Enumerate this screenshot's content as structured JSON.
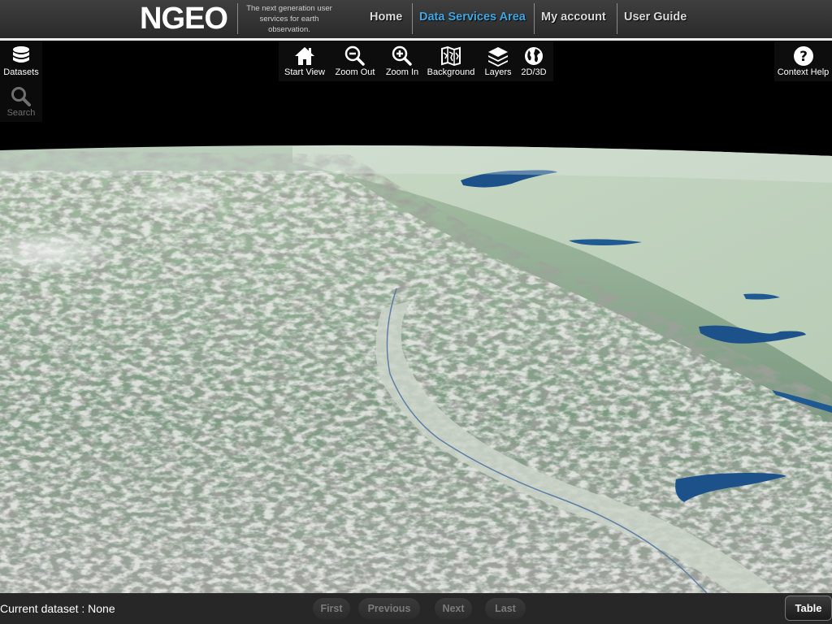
{
  "header": {
    "logo": "NGEO",
    "tagline": "The next generation user services for earth observation.",
    "nav": [
      {
        "label": "Home",
        "active": false
      },
      {
        "label": "Data Services Area",
        "active": true
      },
      {
        "label": "My account",
        "active": false
      },
      {
        "label": "User Guide",
        "active": false
      }
    ]
  },
  "left_toolbar": {
    "datasets": {
      "label": "Datasets",
      "icon": "database-icon"
    },
    "search": {
      "label": "Search",
      "icon": "search-icon",
      "enabled": false
    }
  },
  "map_toolbar": {
    "start_view": {
      "label": "Start View",
      "icon": "home-icon"
    },
    "zoom_out": {
      "label": "Zoom Out",
      "icon": "zoom-out-icon"
    },
    "zoom_in": {
      "label": "Zoom In",
      "icon": "zoom-in-icon"
    },
    "background": {
      "label": "Background",
      "icon": "map-icon"
    },
    "layers": {
      "label": "Layers",
      "icon": "layers-icon"
    },
    "view_mode": {
      "label": "2D/3D",
      "icon": "globe-icon"
    }
  },
  "right_toolbar": {
    "context_help": {
      "label": "Context Help",
      "icon": "help-icon"
    }
  },
  "map": {
    "view": "3D terrain globe view",
    "colors": {
      "sky": "#000000",
      "terrain_green": "#7fa487",
      "lake": "#1c5289"
    }
  },
  "footer": {
    "current_dataset": "Current dataset : None",
    "pager": [
      {
        "label": "First",
        "enabled": false
      },
      {
        "label": "Previous",
        "enabled": false
      },
      {
        "label": "Next",
        "enabled": false
      },
      {
        "label": "Last",
        "enabled": false
      }
    ],
    "table_button": "Table"
  },
  "theme": {
    "accent": "#3da9e6",
    "header_bg": "#333333",
    "toolbar_bg": "#0d0d0d"
  }
}
